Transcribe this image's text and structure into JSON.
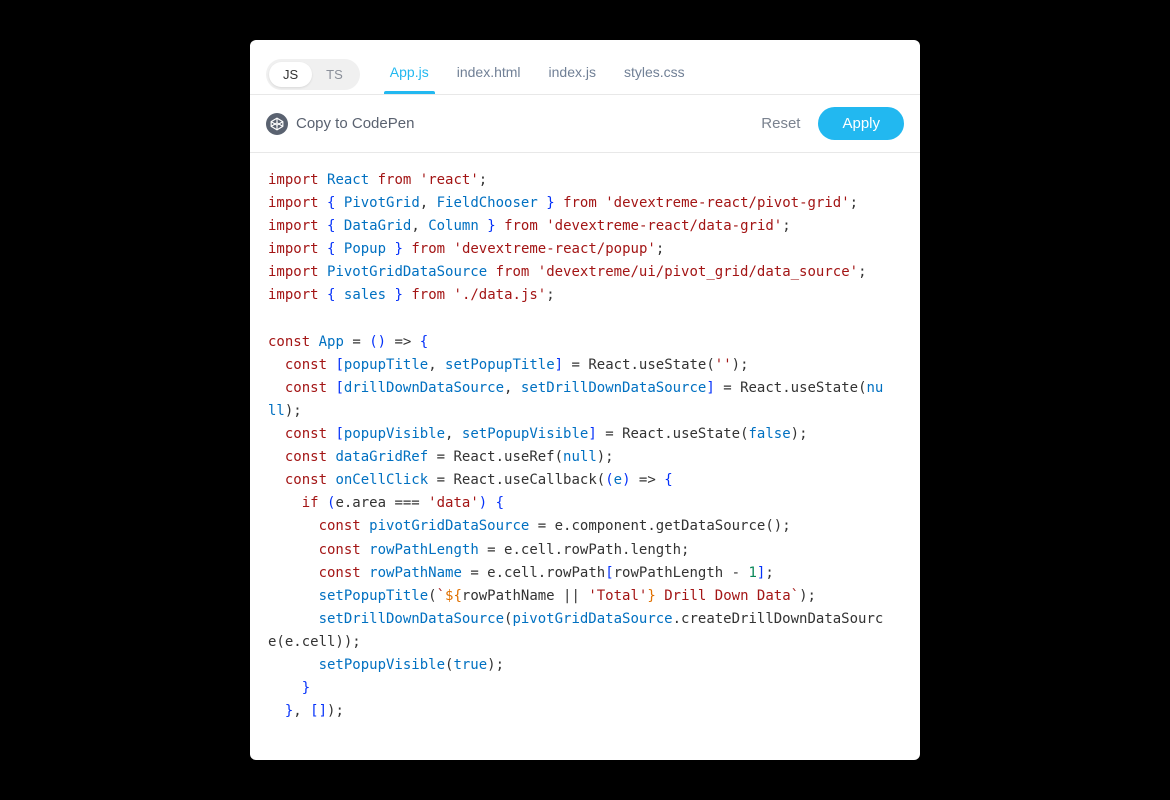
{
  "lang_toggle": {
    "js": "JS",
    "ts": "TS",
    "active": "js"
  },
  "file_tabs": [
    {
      "label": "App.js",
      "active": true
    },
    {
      "label": "index.html",
      "active": false
    },
    {
      "label": "index.js",
      "active": false
    },
    {
      "label": "styles.css",
      "active": false
    }
  ],
  "actions": {
    "codepen": "Copy to CodePen",
    "reset": "Reset",
    "apply": "Apply"
  },
  "code": {
    "tokens": [
      [
        "k",
        "import"
      ],
      [
        "c",
        " "
      ],
      [
        "t",
        "React"
      ],
      [
        "c",
        " "
      ],
      [
        "k",
        "from"
      ],
      [
        "c",
        " "
      ],
      [
        "s",
        "'react'"
      ],
      [
        "c",
        ";\n"
      ],
      [
        "k",
        "import"
      ],
      [
        "c",
        " "
      ],
      [
        "br",
        "{"
      ],
      [
        "c",
        " "
      ],
      [
        "t",
        "PivotGrid"
      ],
      [
        "c",
        ", "
      ],
      [
        "t",
        "FieldChooser"
      ],
      [
        "c",
        " "
      ],
      [
        "br",
        "}"
      ],
      [
        "c",
        " "
      ],
      [
        "k",
        "from"
      ],
      [
        "c",
        " "
      ],
      [
        "s",
        "'devextreme-react/pivot-grid'"
      ],
      [
        "c",
        ";\n"
      ],
      [
        "k",
        "import"
      ],
      [
        "c",
        " "
      ],
      [
        "br",
        "{"
      ],
      [
        "c",
        " "
      ],
      [
        "t",
        "DataGrid"
      ],
      [
        "c",
        ", "
      ],
      [
        "t",
        "Column"
      ],
      [
        "c",
        " "
      ],
      [
        "br",
        "}"
      ],
      [
        "c",
        " "
      ],
      [
        "k",
        "from"
      ],
      [
        "c",
        " "
      ],
      [
        "s",
        "'devextreme-react/data-grid'"
      ],
      [
        "c",
        ";\n"
      ],
      [
        "k",
        "import"
      ],
      [
        "c",
        " "
      ],
      [
        "br",
        "{"
      ],
      [
        "c",
        " "
      ],
      [
        "t",
        "Popup"
      ],
      [
        "c",
        " "
      ],
      [
        "br",
        "}"
      ],
      [
        "c",
        " "
      ],
      [
        "k",
        "from"
      ],
      [
        "c",
        " "
      ],
      [
        "s",
        "'devextreme-react/popup'"
      ],
      [
        "c",
        ";\n"
      ],
      [
        "k",
        "import"
      ],
      [
        "c",
        " "
      ],
      [
        "t",
        "PivotGridDataSource"
      ],
      [
        "c",
        " "
      ],
      [
        "k",
        "from"
      ],
      [
        "c",
        " "
      ],
      [
        "s",
        "'devextreme/ui/pivot_grid/data_source'"
      ],
      [
        "c",
        ";\n"
      ],
      [
        "k",
        "import"
      ],
      [
        "c",
        " "
      ],
      [
        "br",
        "{"
      ],
      [
        "c",
        " "
      ],
      [
        "t",
        "sales"
      ],
      [
        "c",
        " "
      ],
      [
        "br",
        "}"
      ],
      [
        "c",
        " "
      ],
      [
        "k",
        "from"
      ],
      [
        "c",
        " "
      ],
      [
        "s",
        "'./data.js'"
      ],
      [
        "c",
        ";\n\n"
      ],
      [
        "k",
        "const"
      ],
      [
        "c",
        " "
      ],
      [
        "t",
        "App"
      ],
      [
        "c",
        " = "
      ],
      [
        "br",
        "("
      ],
      [
        "br",
        ")"
      ],
      [
        "c",
        " => "
      ],
      [
        "br",
        "{"
      ],
      [
        "c",
        "\n"
      ],
      [
        "c",
        "  "
      ],
      [
        "k",
        "const"
      ],
      [
        "c",
        " "
      ],
      [
        "br",
        "["
      ],
      [
        "t",
        "popupTitle"
      ],
      [
        "c",
        ", "
      ],
      [
        "t",
        "setPopupTitle"
      ],
      [
        "br",
        "]"
      ],
      [
        "c",
        " = React.useState("
      ],
      [
        "s",
        "''"
      ],
      [
        "c",
        ");\n"
      ],
      [
        "c",
        "  "
      ],
      [
        "k",
        "const"
      ],
      [
        "c",
        " "
      ],
      [
        "br",
        "["
      ],
      [
        "t",
        "drillDownDataSource"
      ],
      [
        "c",
        ", "
      ],
      [
        "t",
        "setDrillDownDataSource"
      ],
      [
        "br",
        "]"
      ],
      [
        "c",
        " = React.useState("
      ],
      [
        "t",
        "nu\nll"
      ],
      [
        "c",
        ");\n"
      ],
      [
        "c",
        "  "
      ],
      [
        "k",
        "const"
      ],
      [
        "c",
        " "
      ],
      [
        "br",
        "["
      ],
      [
        "t",
        "popupVisible"
      ],
      [
        "c",
        ", "
      ],
      [
        "t",
        "setPopupVisible"
      ],
      [
        "br",
        "]"
      ],
      [
        "c",
        " = React.useState("
      ],
      [
        "t",
        "false"
      ],
      [
        "c",
        ");\n"
      ],
      [
        "c",
        "  "
      ],
      [
        "k",
        "const"
      ],
      [
        "c",
        " "
      ],
      [
        "t",
        "dataGridRef"
      ],
      [
        "c",
        " = React.useRef("
      ],
      [
        "t",
        "null"
      ],
      [
        "c",
        ");\n"
      ],
      [
        "c",
        "  "
      ],
      [
        "k",
        "const"
      ],
      [
        "c",
        " "
      ],
      [
        "t",
        "onCellClick"
      ],
      [
        "c",
        " = React.useCallback("
      ],
      [
        "br",
        "("
      ],
      [
        "t",
        "e"
      ],
      [
        "br",
        ")"
      ],
      [
        "c",
        " => "
      ],
      [
        "br",
        "{"
      ],
      [
        "c",
        "\n"
      ],
      [
        "c",
        "    "
      ],
      [
        "k",
        "if"
      ],
      [
        "c",
        " "
      ],
      [
        "br",
        "("
      ],
      [
        "c",
        "e.area === "
      ],
      [
        "s",
        "'data'"
      ],
      [
        "br",
        ")"
      ],
      [
        "c",
        " "
      ],
      [
        "br",
        "{"
      ],
      [
        "c",
        "\n"
      ],
      [
        "c",
        "      "
      ],
      [
        "k",
        "const"
      ],
      [
        "c",
        " "
      ],
      [
        "t",
        "pivotGridDataSource"
      ],
      [
        "c",
        " = e.component.getDataSource();\n"
      ],
      [
        "c",
        "      "
      ],
      [
        "k",
        "const"
      ],
      [
        "c",
        " "
      ],
      [
        "t",
        "rowPathLength"
      ],
      [
        "c",
        " = e.cell.rowPath.length;\n"
      ],
      [
        "c",
        "      "
      ],
      [
        "k",
        "const"
      ],
      [
        "c",
        " "
      ],
      [
        "t",
        "rowPathName"
      ],
      [
        "c",
        " = e.cell.rowPath"
      ],
      [
        "br",
        "["
      ],
      [
        "c",
        "rowPathLength - "
      ],
      [
        "n",
        "1"
      ],
      [
        "br",
        "]"
      ],
      [
        "c",
        ";\n"
      ],
      [
        "c",
        "      "
      ],
      [
        "t",
        "setPopupTitle"
      ],
      [
        "c",
        "("
      ],
      [
        "s",
        "`"
      ],
      [
        "tmpl",
        "${"
      ],
      [
        "c",
        "rowPathName || "
      ],
      [
        "s",
        "'Total'"
      ],
      [
        "tmpl",
        "}"
      ],
      [
        "s",
        " Drill Down Data`"
      ],
      [
        "c",
        ");\n"
      ],
      [
        "c",
        "      "
      ],
      [
        "t",
        "setDrillDownDataSource"
      ],
      [
        "c",
        "("
      ],
      [
        "t",
        "pivotGridDataSource"
      ],
      [
        "c",
        ".createDrillDownDataSourc\ne(e.cell));\n"
      ],
      [
        "c",
        "      "
      ],
      [
        "t",
        "setPopupVisible"
      ],
      [
        "c",
        "("
      ],
      [
        "t",
        "true"
      ],
      [
        "c",
        ");\n"
      ],
      [
        "c",
        "    "
      ],
      [
        "br",
        "}"
      ],
      [
        "c",
        "\n"
      ],
      [
        "c",
        "  "
      ],
      [
        "br",
        "}"
      ],
      [
        "c",
        ", "
      ],
      [
        "br",
        "["
      ],
      [
        "br",
        "]"
      ],
      [
        "c",
        ");\n"
      ]
    ]
  }
}
